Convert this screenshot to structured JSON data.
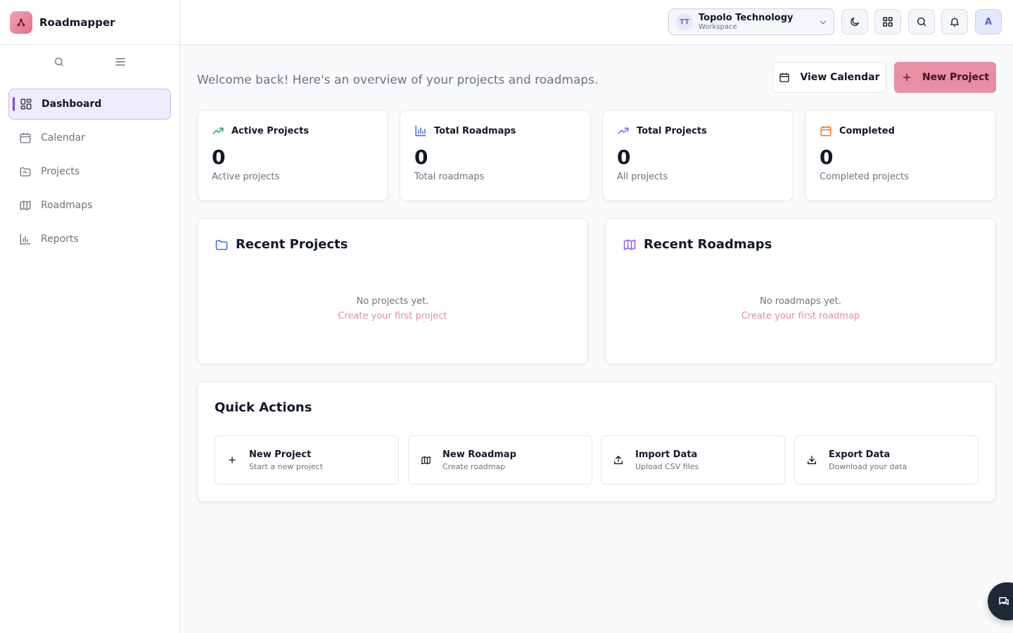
{
  "app": {
    "name": "Roadmapper"
  },
  "sidebar": {
    "items": [
      {
        "label": "Dashboard",
        "icon": "dashboard-icon",
        "active": true
      },
      {
        "label": "Calendar",
        "icon": "calendar-icon"
      },
      {
        "label": "Projects",
        "icon": "folder-icon"
      },
      {
        "label": "Roadmaps",
        "icon": "map-icon"
      },
      {
        "label": "Reports",
        "icon": "bar-chart-icon"
      }
    ]
  },
  "header": {
    "workspace": {
      "initials": "TT",
      "name": "Topolo Technology",
      "sub": "Workspace"
    },
    "avatar": "A"
  },
  "main": {
    "welcome": "Welcome back! Here's an overview of your projects and roadmaps.",
    "view_calendar": "View Calendar",
    "new_project": "New Project",
    "stats": [
      {
        "title": "Active Projects",
        "value": "0",
        "sub": "Active projects",
        "color": "#22a06b"
      },
      {
        "title": "Total Roadmaps",
        "value": "0",
        "sub": "Total roadmaps",
        "color": "#3b6fd8"
      },
      {
        "title": "Total Projects",
        "value": "0",
        "sub": "All projects",
        "color": "#8b5cf6"
      },
      {
        "title": "Completed",
        "value": "0",
        "sub": "Completed projects",
        "color": "#f97316"
      }
    ],
    "recent_projects": {
      "title": "Recent Projects",
      "empty": "No projects yet.",
      "cta": "Create your first project"
    },
    "recent_roadmaps": {
      "title": "Recent Roadmaps",
      "empty": "No roadmaps yet.",
      "cta": "Create your first roadmap"
    },
    "quick_actions": {
      "title": "Quick Actions",
      "items": [
        {
          "label": "New Project",
          "sub": "Start a new project",
          "icon": "plus-icon"
        },
        {
          "label": "New Roadmap",
          "sub": "Create roadmap",
          "icon": "map-icon"
        },
        {
          "label": "Import Data",
          "sub": "Upload CSV files",
          "icon": "upload-icon"
        },
        {
          "label": "Export Data",
          "sub": "Download your data",
          "icon": "download-icon"
        }
      ]
    }
  },
  "colors": {
    "accent": "#ea8ea5",
    "active_bar": "#7c4ddb",
    "link": "#e58ba0"
  }
}
